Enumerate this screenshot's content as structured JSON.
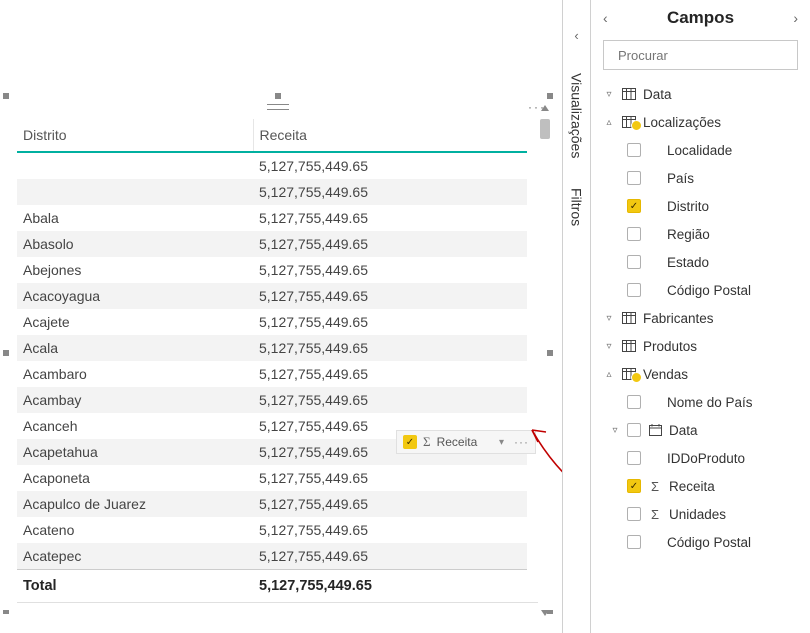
{
  "panes": {
    "visualizations_label": "Visualizações",
    "filters_label": "Filtros"
  },
  "fields_panel": {
    "title": "Campos",
    "search_placeholder": "Procurar"
  },
  "field_chip": {
    "label": "Receita"
  },
  "tree": {
    "t0": "Data",
    "t1": "Localizações",
    "t1_0": "Localidade",
    "t1_1": "País",
    "t1_2": "Distrito",
    "t1_3": "Região",
    "t1_4": "Estado",
    "t1_5": "Código Postal",
    "t2": "Fabricantes",
    "t3": "Produtos",
    "t4": "Vendas",
    "t4_0": "Nome do País",
    "t4_1": "Data",
    "t4_2": "IDDoProduto",
    "t4_3": "Receita",
    "t4_4": "Unidades",
    "t4_5": "Código Postal"
  },
  "table": {
    "col1": "Distrito",
    "col2": "Receita",
    "rows": [
      {
        "d": "",
        "r": "5,127,755,449.65"
      },
      {
        "d": "",
        "r": "5,127,755,449.65"
      },
      {
        "d": "Abala",
        "r": "5,127,755,449.65"
      },
      {
        "d": "Abasolo",
        "r": "5,127,755,449.65"
      },
      {
        "d": "Abejones",
        "r": "5,127,755,449.65"
      },
      {
        "d": "Acacoyagua",
        "r": "5,127,755,449.65"
      },
      {
        "d": "Acajete",
        "r": "5,127,755,449.65"
      },
      {
        "d": "Acala",
        "r": "5,127,755,449.65"
      },
      {
        "d": "Acambaro",
        "r": "5,127,755,449.65"
      },
      {
        "d": "Acambay",
        "r": "5,127,755,449.65"
      },
      {
        "d": "Acanceh",
        "r": "5,127,755,449.65"
      },
      {
        "d": "Acapetahua",
        "r": "5,127,755,449.65"
      },
      {
        "d": "Acaponeta",
        "r": "5,127,755,449.65"
      },
      {
        "d": "Acapulco de Juarez",
        "r": "5,127,755,449.65"
      },
      {
        "d": "Acateno",
        "r": "5,127,755,449.65"
      },
      {
        "d": "Acatepec",
        "r": "5,127,755,449.65"
      }
    ],
    "total_label": "Total",
    "total_value": "5,127,755,449.65"
  }
}
